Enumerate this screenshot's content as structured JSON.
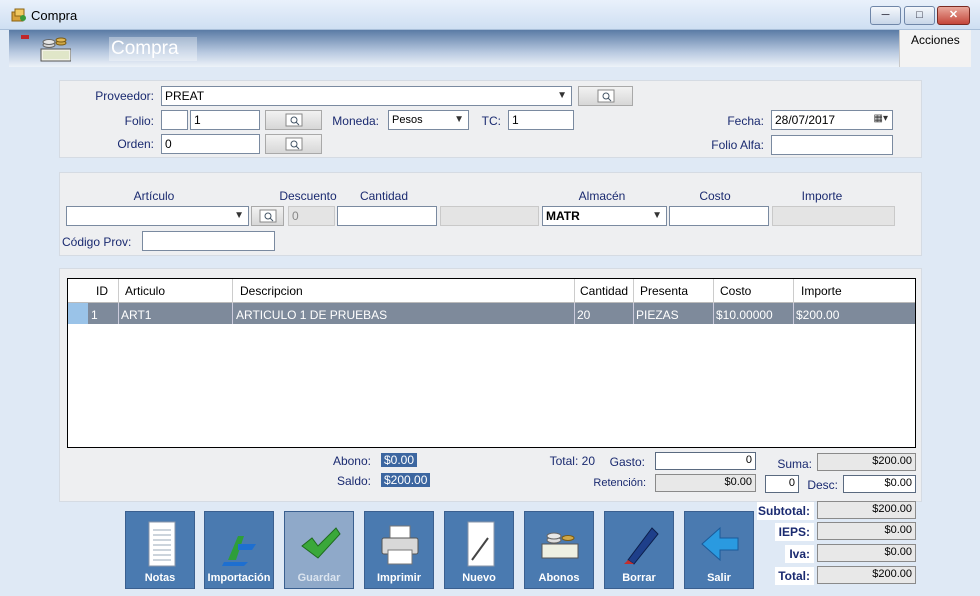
{
  "window": {
    "title": "Compra",
    "min": "─",
    "max": "□",
    "close": "✕"
  },
  "header": {
    "title": "Compra",
    "acciones": "Acciones"
  },
  "form": {
    "proveedor_label": "Proveedor:",
    "proveedor": "PREAT",
    "folio_label": "Folio:",
    "folio_prefix": "",
    "folio": "1",
    "moneda_label": "Moneda:",
    "moneda": "Pesos",
    "tc_label": "TC:",
    "tc": "1",
    "fecha_label": "Fecha:",
    "fecha": "28/07/2017",
    "orden_label": "Orden:",
    "orden": "0",
    "folio_alfa_label": "Folio Alfa:",
    "folio_alfa": ""
  },
  "article": {
    "articulo_label": "Artículo",
    "descuento_label": "Descuento",
    "cantidad_label": "Cantidad",
    "almacen_label": "Almacén",
    "costo_label": "Costo",
    "importe_label": "Importe",
    "articulo": "",
    "descuento": "0",
    "cantidad": "",
    "almacen": "MATR",
    "costo": "",
    "importe": "",
    "codigo_prov_label": "Código Prov:",
    "codigo_prov": ""
  },
  "table": {
    "columns": [
      "ID",
      "Articulo",
      "Descripcion",
      "Cantidad",
      "Presenta",
      "Costo",
      "Importe"
    ],
    "rows": [
      [
        "1",
        "ART1",
        "ARTICULO 1 DE PRUEBAS",
        "20",
        "PIEZAS",
        "$10.00000",
        "$200.00"
      ]
    ]
  },
  "totals": {
    "abono_label": "Abono:",
    "abono": "$0.00",
    "saldo_label": "Saldo:",
    "saldo": "$200.00",
    "total_label": "Total: 20",
    "gasto_label": "Gasto:",
    "gasto": "0",
    "retencion_label": "Retención:",
    "retencion": "$0.00",
    "suma_label": "Suma:",
    "suma": "$200.00",
    "desc_pct": "0",
    "desc_label": "Desc:",
    "desc": "$0.00",
    "subtotal_label": "Subtotal:",
    "subtotal": "$200.00",
    "ieps_label": "IEPS:",
    "ieps": "$0.00",
    "iva_label": "Iva:",
    "iva": "$0.00",
    "grand_label": "Total:",
    "grand": "$200.00"
  },
  "buttons": {
    "notas": "Notas",
    "importacion": "Importación",
    "guardar": "Guardar",
    "imprimir": "Imprimir",
    "nuevo": "Nuevo",
    "abonos": "Abonos",
    "borrar": "Borrar",
    "salir": "Salir"
  },
  "colors": {
    "accent": "#4a7ab0",
    "selected_row": "#7e8a9b",
    "badge": "#3c66a0"
  }
}
